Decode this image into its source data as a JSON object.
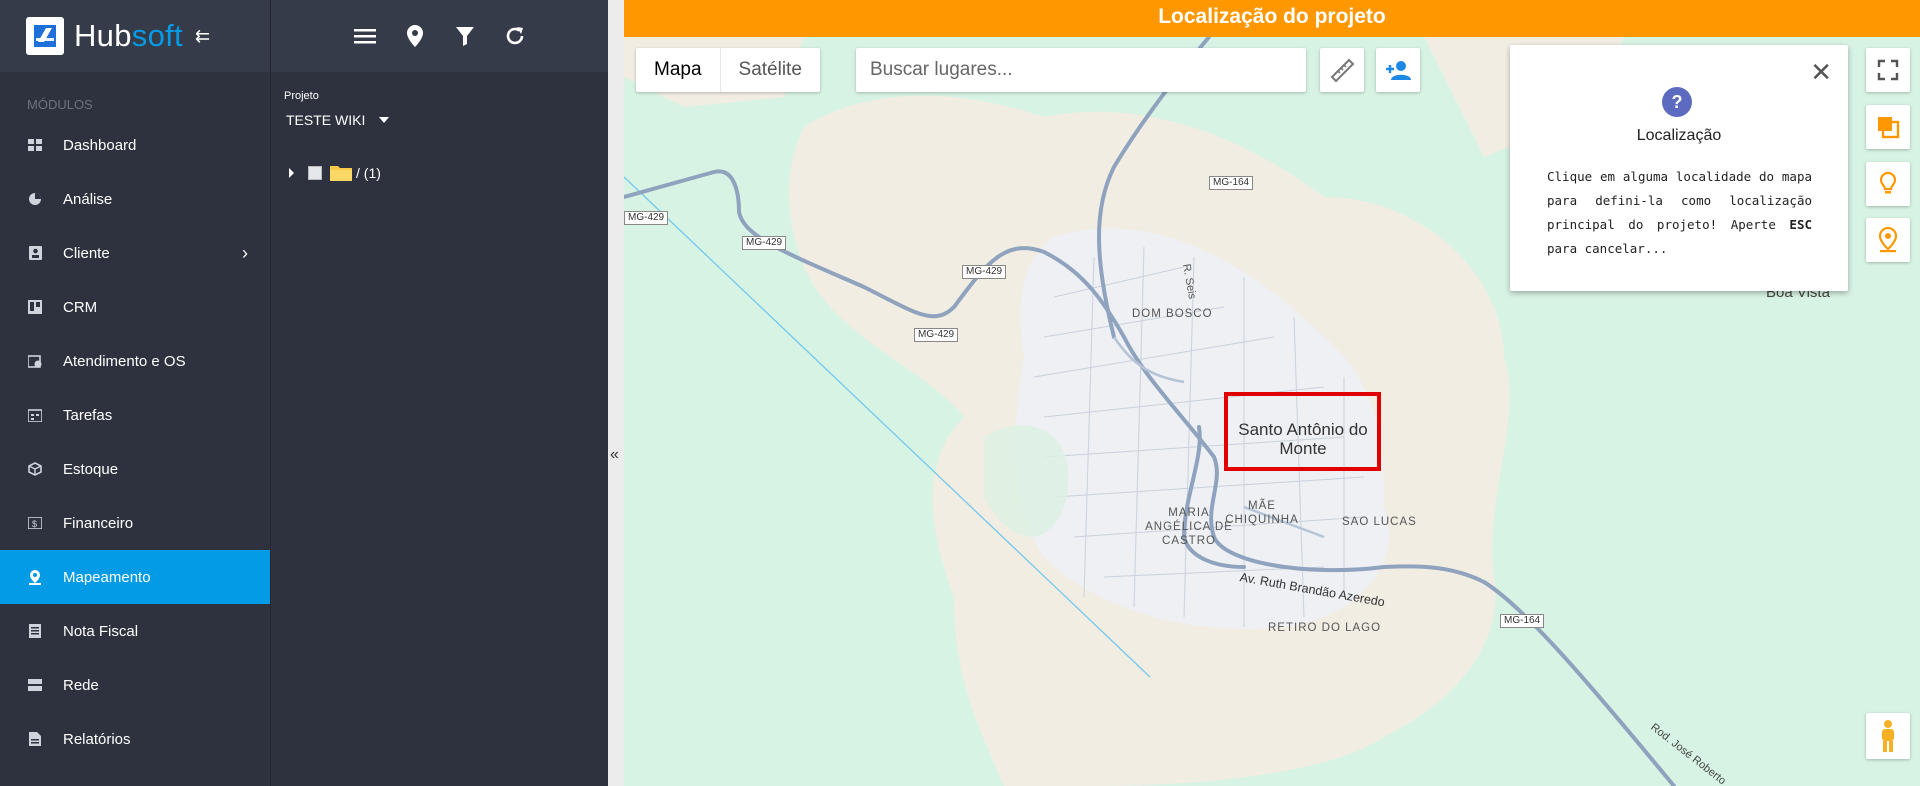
{
  "app": {
    "logo_part1": "Hub",
    "logo_part2": "soft"
  },
  "sidebar": {
    "section_label": "MÓDULOS",
    "items": [
      {
        "label": "Dashboard",
        "icon": "dashboard-icon"
      },
      {
        "label": "Análise",
        "icon": "pie-chart-icon"
      },
      {
        "label": "Cliente",
        "icon": "contact-icon"
      },
      {
        "label": "CRM",
        "icon": "kanban-icon"
      },
      {
        "label": "Atendimento e OS",
        "icon": "clock-calendar-icon"
      },
      {
        "label": "Tarefas",
        "icon": "task-icon"
      },
      {
        "label": "Estoque",
        "icon": "box-icon"
      },
      {
        "label": "Financeiro",
        "icon": "money-icon"
      },
      {
        "label": "Mapeamento",
        "icon": "pin-icon",
        "active": true
      },
      {
        "label": "Nota Fiscal",
        "icon": "receipt-icon"
      },
      {
        "label": "Rede",
        "icon": "server-icon"
      },
      {
        "label": "Relatórios",
        "icon": "report-icon"
      }
    ]
  },
  "tree": {
    "project_label": "Projeto",
    "project_value": "TESTE WIKI",
    "root_label": "/ (1)"
  },
  "map": {
    "header_title": "Localização do projeto",
    "map_type_map": "Mapa",
    "map_type_satellite": "Satélite",
    "search_placeholder": "Buscar lugares...",
    "popup": {
      "title": "Localização",
      "text_1": "Clique em alguma localidade do mapa para defini-la como localização principal do projeto! Aperte ",
      "text_key": "ESC",
      "text_2": " para cancelar..."
    },
    "city": "Santo Antônio do Monte",
    "districts": [
      "DOM BOSCO",
      "MÃE CHIQUINHA",
      "SAO LUCAS",
      "MARIA ANGÉLICA DE CASTRO",
      "RETIRO DO LAGO"
    ],
    "places": [
      "Boa Vista"
    ],
    "streets": [
      "Av. Ruth Brandão Azeredo",
      "R. Seis",
      "Rod. José Roberto"
    ],
    "road_shields": [
      "MG-429",
      "MG-429",
      "MG-429",
      "MG-429",
      "MG-164",
      "MG-164"
    ],
    "colors": {
      "header": "#ff9800",
      "active_nav": "#039be5",
      "highlight": "#e00000",
      "orange_icon": "#ff9800"
    }
  }
}
